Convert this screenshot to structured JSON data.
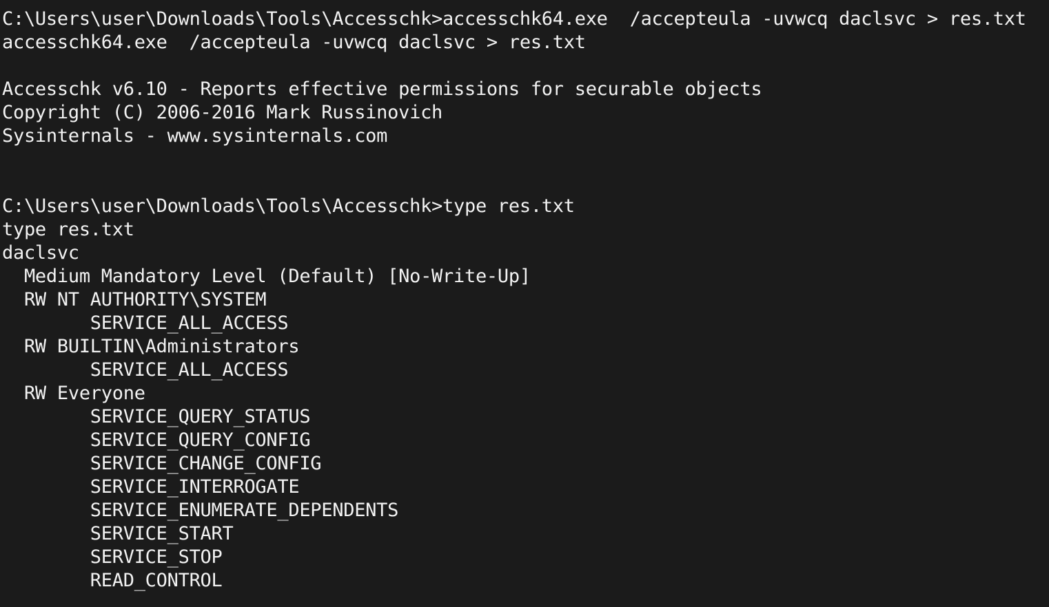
{
  "terminal": {
    "lines": [
      "C:\\Users\\user\\Downloads\\Tools\\Accesschk>accesschk64.exe  /accepteula -uvwcq daclsvc > res.txt",
      "accesschk64.exe  /accepteula -uvwcq daclsvc > res.txt",
      "",
      "Accesschk v6.10 - Reports effective permissions for securable objects",
      "Copyright (C) 2006-2016 Mark Russinovich",
      "Sysinternals - www.sysinternals.com",
      "",
      "",
      "C:\\Users\\user\\Downloads\\Tools\\Accesschk>type res.txt",
      "type res.txt",
      "daclsvc",
      "  Medium Mandatory Level (Default) [No-Write-Up]",
      "  RW NT AUTHORITY\\SYSTEM",
      "        SERVICE_ALL_ACCESS",
      "  RW BUILTIN\\Administrators",
      "        SERVICE_ALL_ACCESS",
      "  RW Everyone",
      "        SERVICE_QUERY_STATUS",
      "        SERVICE_QUERY_CONFIG",
      "        SERVICE_CHANGE_CONFIG",
      "        SERVICE_INTERROGATE",
      "        SERVICE_ENUMERATE_DEPENDENTS",
      "        SERVICE_START",
      "        SERVICE_STOP",
      "        READ_CONTROL"
    ]
  },
  "colors": {
    "background": "#1b1b1b",
    "text": "#f2f2f2"
  }
}
